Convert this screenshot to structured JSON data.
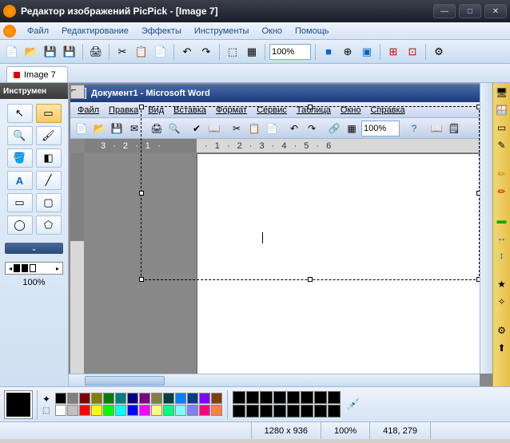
{
  "window": {
    "title": "Редактор изображений PicPick - [Image 7]"
  },
  "menu": {
    "items": [
      "Файл",
      "Редактирование",
      "Эффекты",
      "Инструменты",
      "Окно",
      "Помощь"
    ]
  },
  "toolbar": {
    "zoom": "100%"
  },
  "tabs": {
    "active": "Image 7"
  },
  "left_panel": {
    "title": "Инструмен",
    "thickness_pct": "100%"
  },
  "word_window": {
    "title": "Документ1 - Microsoft Word",
    "menu": [
      "Файл",
      "Правка",
      "Вид",
      "Вставка",
      "Формат",
      "Сервис",
      "Таблица",
      "Окно",
      "Справка"
    ],
    "zoom": "100%",
    "ruler_dark": "3 · 2 · 1 ·",
    "ruler_light": "· 1 · 2 · 3 · 4 · 5 · 6"
  },
  "palette": {
    "colors_row1": [
      "#000000",
      "#808080",
      "#800000",
      "#808000",
      "#008000",
      "#008080",
      "#000080",
      "#800080",
      "#808040",
      "#004040",
      "#0080ff",
      "#004080",
      "#8000ff",
      "#804000"
    ],
    "colors_row2": [
      "#ffffff",
      "#c0c0c0",
      "#ff0000",
      "#ffff00",
      "#00ff00",
      "#00ffff",
      "#0000ff",
      "#ff00ff",
      "#ffff80",
      "#00ff80",
      "#80ffff",
      "#8080ff",
      "#ff0080",
      "#ff8040"
    ]
  },
  "status": {
    "dimensions": "1280 x 936",
    "zoom": "100%",
    "coords": "418, 279"
  }
}
